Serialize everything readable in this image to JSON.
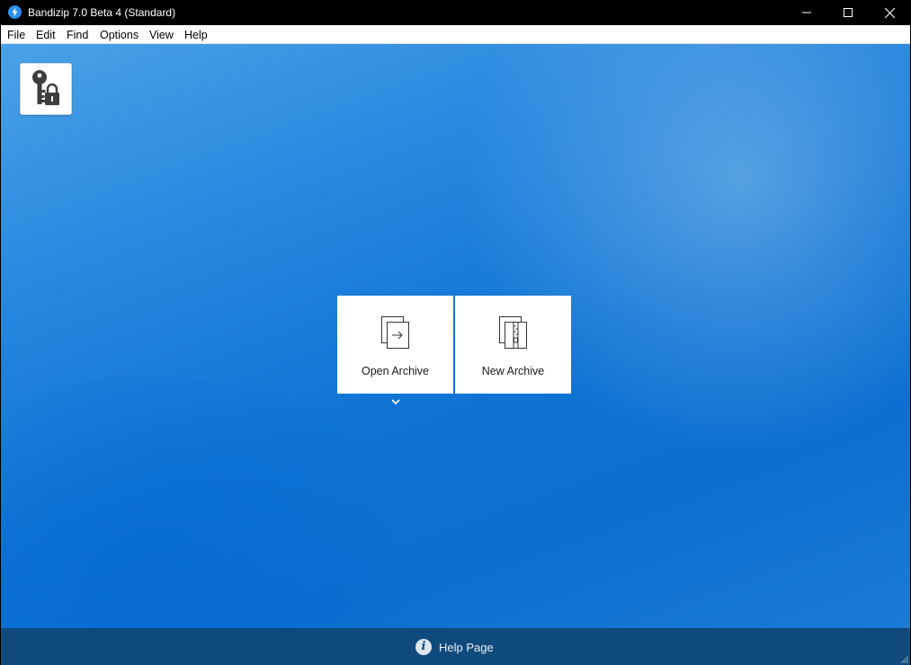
{
  "window": {
    "title": "Bandizip 7.0 Beta 4 (Standard)",
    "app_icon": "bandizip-lightning-icon",
    "controls": [
      "minimize-icon",
      "maximize-icon",
      "close-icon"
    ]
  },
  "menubar": {
    "items": [
      {
        "label": "File"
      },
      {
        "label": "Edit"
      },
      {
        "label": "Find"
      },
      {
        "label": "Options"
      },
      {
        "label": "View"
      },
      {
        "label": "Help"
      }
    ]
  },
  "toolbar": {
    "password_manager_icon": "key-lock-icon"
  },
  "tiles": {
    "open_archive": {
      "label": "Open Archive",
      "icon": "open-archive-icon",
      "dropdown_icon": "chevron-down-icon"
    },
    "new_archive": {
      "label": "New Archive",
      "icon": "new-archive-icon"
    }
  },
  "footer": {
    "help_label": "Help Page",
    "help_icon": "info-icon",
    "help_icon_glyph": "i"
  },
  "colors": {
    "titlebar": "#000000",
    "background_blue": "#0f74d4",
    "footer": "#0f4a7c",
    "app_icon": "#2a8ff0"
  }
}
